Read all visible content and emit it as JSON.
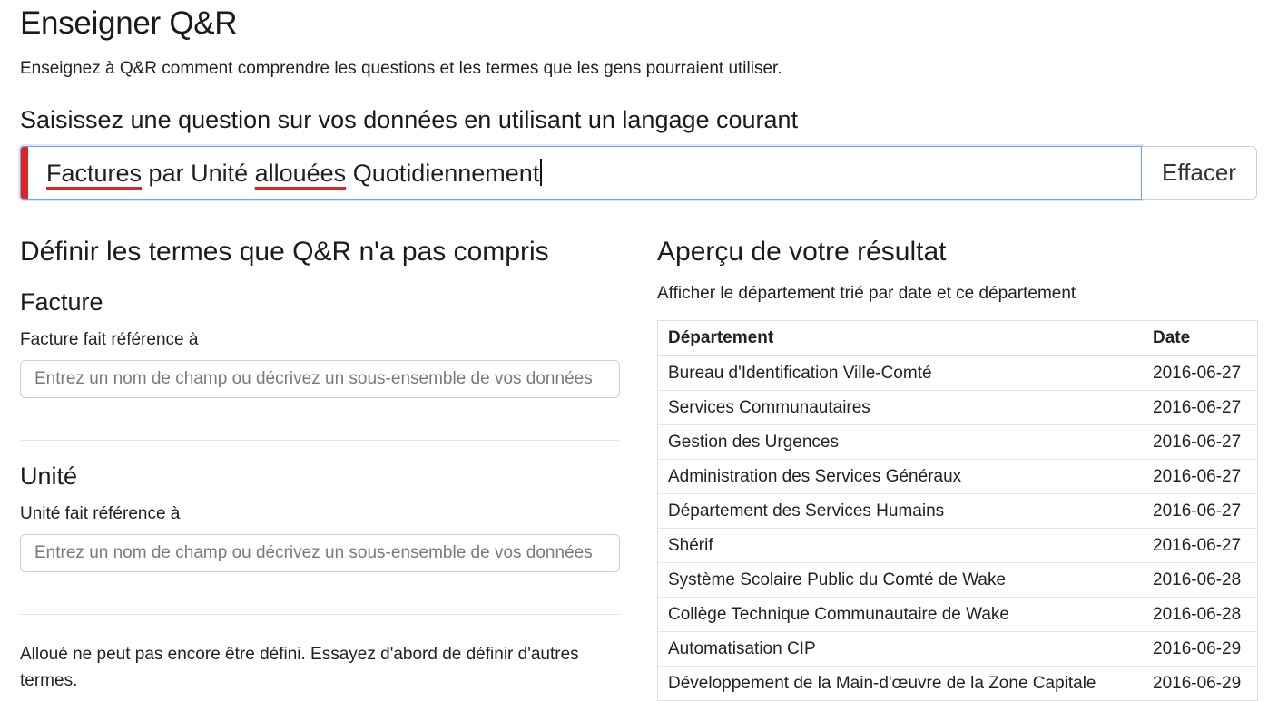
{
  "page": {
    "title": "Enseigner Q&R",
    "subtitle": "Enseignez à Q&R comment comprendre les questions et les termes que les gens pourraient utiliser.",
    "prompt": "Saisissez une question sur vos données en utilisant un langage courant"
  },
  "question": {
    "segments": [
      {
        "text": "Factures",
        "flagged": true
      },
      {
        "text": " par Unité ",
        "flagged": false
      },
      {
        "text": "allouées",
        "flagged": true
      },
      {
        "text": " Quotidiennement",
        "flagged": false
      }
    ],
    "clear_label": "Effacer",
    "error_color": "#e02424"
  },
  "define": {
    "heading": "Définir les termes que Q&R n'a pas compris",
    "terms": [
      {
        "name": "Facture",
        "label": "Facture fait référence à",
        "placeholder": "Entrez un nom de champ ou décrivez un sous-ensemble de vos données"
      },
      {
        "name": "Unité",
        "label": "Unité fait référence à",
        "placeholder": "Entrez un nom de champ ou décrivez un sous-ensemble de vos données"
      }
    ],
    "note": "Alloué ne peut pas encore être défini. Essayez d'abord de définir d'autres termes."
  },
  "preview": {
    "heading": "Aperçu de votre résultat",
    "description": "Afficher le département trié par date et ce département",
    "columns": [
      "Département",
      "Date"
    ],
    "rows": [
      [
        "Bureau d'Identification Ville-Comté",
        "2016-06-27"
      ],
      [
        "Services Communautaires",
        "2016-06-27"
      ],
      [
        "Gestion des Urgences",
        "2016-06-27"
      ],
      [
        "Administration des Services Généraux",
        "2016-06-27"
      ],
      [
        "Département des Services Humains",
        "2016-06-27"
      ],
      [
        "Shérif",
        "2016-06-27"
      ],
      [
        "Système Scolaire Public du Comté de Wake",
        "2016-06-28"
      ],
      [
        "Collège Technique Communautaire de Wake",
        "2016-06-28"
      ],
      [
        "Automatisation CIP",
        "2016-06-29"
      ],
      [
        "Développement de la Main-d'œuvre de la Zone Capitale",
        "2016-06-29"
      ]
    ]
  }
}
